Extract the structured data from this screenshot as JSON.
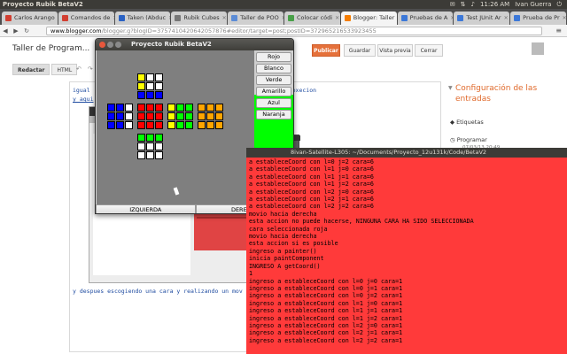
{
  "panel": {
    "title": "Proyecto Rubik BetaV2",
    "clock": "11:26 AM",
    "user": "Ivan Guerra"
  },
  "browser": {
    "tabs": [
      {
        "label": "Carlos Arango",
        "color": "#d23f31"
      },
      {
        "label": "Comandos de",
        "color": "#d23f31"
      },
      {
        "label": "Taken (Abduc",
        "color": "#2a62c4"
      },
      {
        "label": "Rubik Cubes",
        "color": "#777777"
      },
      {
        "label": "Taller de POO",
        "color": "#5c8cd6"
      },
      {
        "label": "Colocar códi",
        "color": "#48a048"
      },
      {
        "label": "Blogger: Taller",
        "color": "#f57d00"
      },
      {
        "label": "Pruebas de A",
        "color": "#3c78d8"
      },
      {
        "label": "Test JUnit Ar",
        "color": "#3c78d8"
      },
      {
        "label": "Prueba de Pr",
        "color": "#3c78d8"
      }
    ],
    "url_host": "www.blogger.com",
    "url_path": "/blogger.g?blogID=3757410420642057876#editor/target=post;postID=372965216533923455"
  },
  "blogger": {
    "post_title": "Taller de Program...",
    "publish": "Publicar",
    "save": "Guardar",
    "preview": "Vista previa",
    "close": "Cerrar",
    "compose": "Redactar",
    "html": "HTML",
    "text_line1": "igual",
    "text_line1b": "anzaza esa execion",
    "text_line2": "y aqui",
    "text_bottom": "y despues escogiendo una cara y realizando un mov",
    "sidebar_title": "Configuración de las entradas",
    "labels": "Etiquetas",
    "schedule": "Programar",
    "schedule_sub": "07/03/13 20:49"
  },
  "app": {
    "title": "Proyecto Rubik BetaV2",
    "colors": {
      "white": "#ffffff",
      "yellow": "#ffff00",
      "blue": "#0000ff",
      "red": "#ff0000",
      "green": "#00ff00",
      "orange": "#ffa500"
    },
    "buttons": [
      "Rojo",
      "Blanco",
      "Verde",
      "Amarillo",
      "Azul",
      "Naranja"
    ],
    "left_button": "IZQUIERDA",
    "right_button": "DERECHA"
  },
  "terminal": {
    "title": "8ivan-Satellite-L305: ~/Documents/Proyecto_12u131k/Code/BetaV2",
    "lines": [
      "a estableceCoord con l=0 j=2 cara=6",
      "a estableceCoord con l=1 j=0 cara=6",
      "a estableceCoord con l=1 j=1 cara=6",
      "a estableceCoord con l=1 j=2 cara=6",
      "a estableceCoord con l=2 j=0 cara=6",
      "a estableceCoord con l=2 j=1 cara=6",
      "a estableceCoord con l=2 j=2 cara=6",
      "movio hacia derecha",
      "esta accion no puede hacerse, NINGUNA CARA HA SIDO SELECCIONADA",
      "cara seleccionada roja",
      "movio hacia derecha",
      "esta accion si es posible",
      "ingreso a painter()",
      "inicia paintComponent",
      "INGRESO A getCoord()",
      "1",
      "ingreso a estableceCoord con l=0 j=0 cara=1",
      "ingreso a estableceCoord con l=0 j=1 cara=1",
      "ingreso a estableceCoord con l=0 j=2 cara=1",
      "ingreso a estableceCoord con l=1 j=0 cara=1",
      "ingreso a estableceCoord con l=1 j=1 cara=1",
      "ingreso a estableceCoord con l=1 j=2 cara=1",
      "ingreso a estableceCoord con l=2 j=0 cara=1",
      "ingreso a estableceCoord con l=2 j=1 cara=1",
      "ingreso a estableceCoord con l=2 j=2 cara=1"
    ]
  }
}
